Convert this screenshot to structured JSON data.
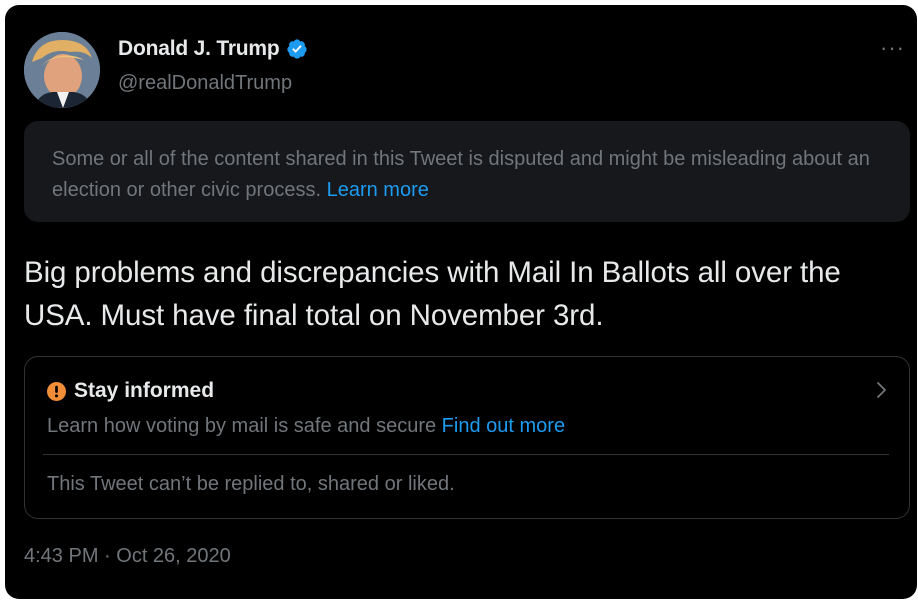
{
  "author": {
    "name": "Donald J. Trump",
    "handle": "@realDonaldTrump",
    "verified": true
  },
  "more_label": "···",
  "warning": {
    "text": "Some or all of the content shared in this Tweet is disputed and might be misleading about an election or other civic process.",
    "link": "Learn more"
  },
  "tweet_text": "Big problems and discrepancies with Mail In Ballots all over the USA. Must have final total on November 3rd.",
  "notice": {
    "title": "Stay informed",
    "subtitle": "Learn how voting by mail is safe and secure",
    "link": "Find out more",
    "footer": "This Tweet can’t be replied to, shared or liked."
  },
  "timestamp": "4:43 PM · Oct 26, 2020",
  "colors": {
    "background": "#000000",
    "primary_text": "#e7e9ea",
    "secondary_text": "#71767b",
    "link": "#1d9bf0",
    "alert": "#f18d36"
  },
  "icons": [
    "avatar",
    "verified-badge-icon",
    "more-options-icon",
    "alert-icon",
    "chevron-right-icon"
  ]
}
